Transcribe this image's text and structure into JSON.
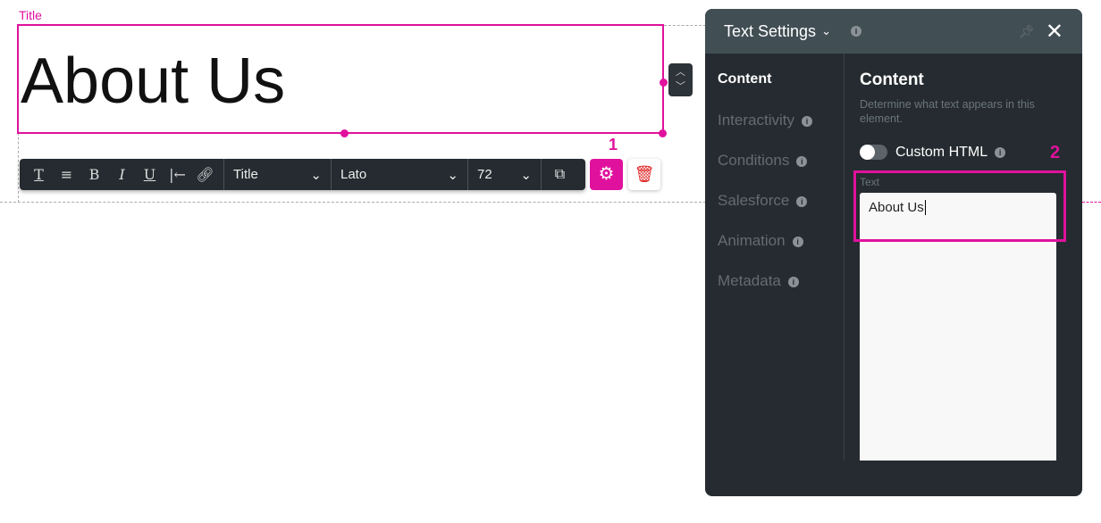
{
  "canvas": {
    "element_label": "Title",
    "heading": "About Us"
  },
  "toolbar": {
    "style_select": "Title",
    "font_select": "Lato",
    "size_select": "72"
  },
  "callouts": {
    "one": "1",
    "two": "2"
  },
  "panel": {
    "title": "Text Settings",
    "nav": [
      {
        "label": "Content"
      },
      {
        "label": "Interactivity"
      },
      {
        "label": "Conditions"
      },
      {
        "label": "Salesforce"
      },
      {
        "label": "Animation"
      },
      {
        "label": "Metadata"
      }
    ],
    "section_title": "Content",
    "section_desc": "Determine what text appears in this element.",
    "custom_html_label": "Custom HTML",
    "custom_html_on": false,
    "text_label": "Text",
    "text_value": "About Us"
  },
  "colors": {
    "accent": "#e0119d",
    "panel_bg": "#252b30",
    "header_bg": "#414e54",
    "delete": "#e02020"
  }
}
